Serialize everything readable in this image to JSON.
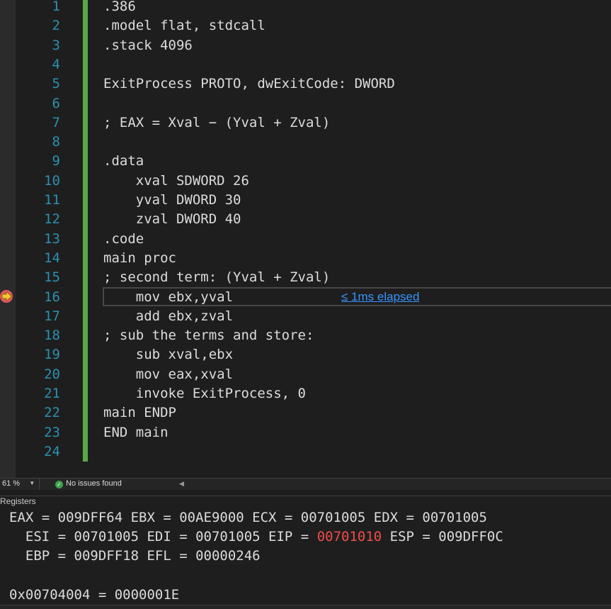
{
  "editor": {
    "line_numbers": [
      "1",
      "2",
      "3",
      "4",
      "5",
      "6",
      "7",
      "8",
      "9",
      "10",
      "11",
      "12",
      "13",
      "14",
      "15",
      "16",
      "17",
      "18",
      "19",
      "20",
      "21",
      "22",
      "23",
      "24"
    ],
    "lines": [
      ".386",
      ".model flat, stdcall",
      ".stack 4096",
      "",
      "ExitProcess PROTO, dwExitCode: DWORD",
      "",
      "; EAX = Xval − (Yval + Zval)",
      "",
      ".data",
      "    xval SDWORD 26",
      "    yval DWORD 30",
      "    zval DWORD 40",
      ".code",
      "main proc",
      "; second term: (Yval + Zval)",
      "    mov ebx,yval",
      "    add ebx,zval",
      "; sub the terms and store:",
      "    sub xval,ebx",
      "    mov eax,xval",
      "    invoke ExitProcess, 0",
      "main ENDP",
      "END main",
      ""
    ],
    "current_line": "16",
    "elapsed_label": "≤ 1ms elapsed"
  },
  "status_bar": {
    "zoom": "61 %",
    "issues": "No issues found"
  },
  "registers": {
    "title": "Registers",
    "row1": "EAX = 009DFF64 EBX = 00AE9000 ECX = 00701005 EDX = 00701005",
    "row2_prefix": "  ESI = 00701005 EDI = 00701005 EIP = ",
    "row2_changed": "00701010",
    "row2_suffix": " ESP = 009DFF0C",
    "row3": "  EBP = 009DFF18 EFL = 00000246",
    "memory": "0x00704004 = 0000001E"
  },
  "bottom_zoom": "61 %",
  "colors": {
    "line_number": "#2b91af",
    "change_bar": "#58a845",
    "changed_register": "#f14c4c",
    "link": "#3794ff"
  },
  "icons": {
    "breakpoint_arrow": "current-statement-arrow-icon",
    "status_ok": "check-circle-icon"
  }
}
